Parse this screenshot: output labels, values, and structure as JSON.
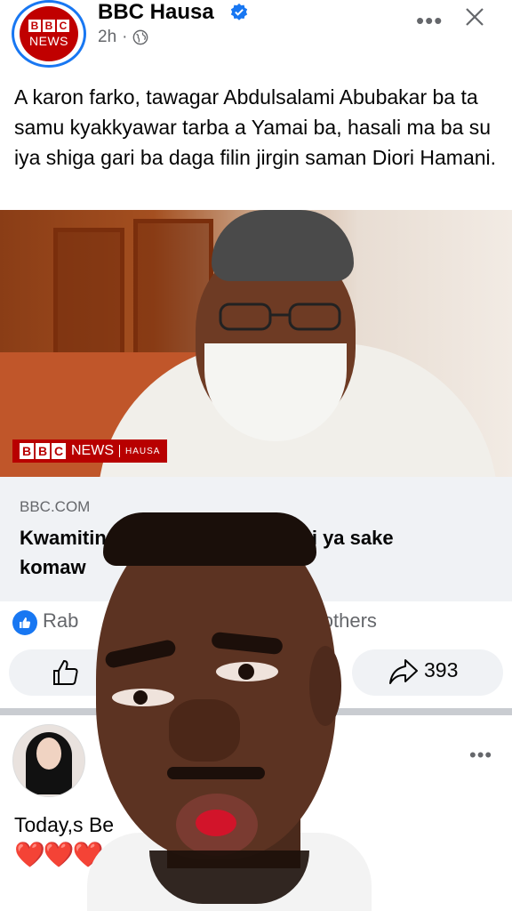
{
  "post": {
    "page_name": "BBC Hausa",
    "avatar_bbc_letters": [
      "B",
      "B",
      "C"
    ],
    "avatar_news": "NEWS",
    "time": "2h",
    "time_sep": "·",
    "more": "•••",
    "caption": "A karon farko, tawagar Abdulsalami Abubakar ba ta samu kyakkyawar tarba a Yamai ba, hasali ma ba su iya shiga gari ba daga filin jirgin saman Diori Hamani."
  },
  "image": {
    "tag_letters": [
      "B",
      "B",
      "C"
    ],
    "tag_news": "NEWS",
    "tag_hausa": "HAUSA"
  },
  "link": {
    "domain": "BBC.COM",
    "title_part1": "Kwamitin",
    "title_part2": "higa tsakani ya sake",
    "title_line2": "komaw"
  },
  "reactions": {
    "name_partial": "Rab",
    "others": "K others",
    "share_count": "393"
  },
  "comment": {
    "more": "•••",
    "text": "Today,s Be",
    "hearts": "❤️❤️❤️"
  },
  "colors": {
    "accent": "#1877f2",
    "bbc_red": "#b80000",
    "secondary_text": "#65676b"
  }
}
